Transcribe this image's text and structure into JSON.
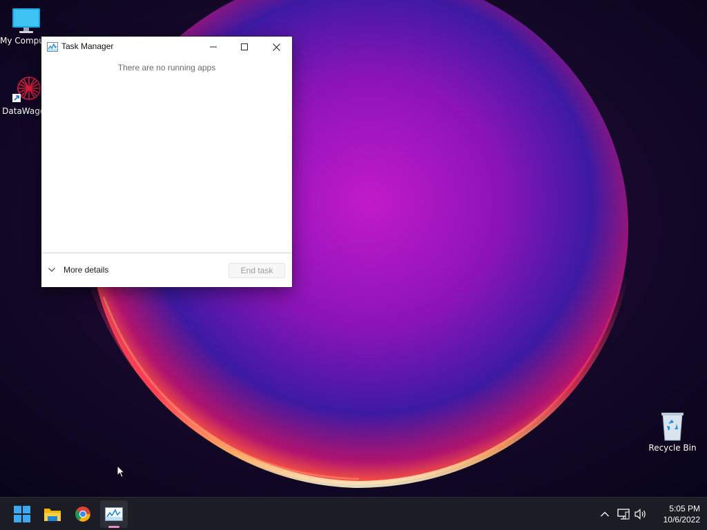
{
  "desktop": {
    "icons": [
      {
        "label": "My Computer",
        "icon": "monitor-icon"
      },
      {
        "label": "DataWagon",
        "icon": "datawagon-icon"
      },
      {
        "label": "Recycle Bin",
        "icon": "recycle-bin-icon"
      }
    ]
  },
  "task_manager": {
    "title": "Task Manager",
    "empty_message": "There are no running apps",
    "more_details_label": "More details",
    "end_task_label": "End task",
    "end_task_enabled": false
  },
  "taskbar": {
    "apps": [
      {
        "name": "Start",
        "icon": "windows-start-icon"
      },
      {
        "name": "File Explorer",
        "icon": "folder-icon"
      },
      {
        "name": "Google Chrome",
        "icon": "chrome-icon"
      },
      {
        "name": "Task Manager",
        "icon": "task-manager-icon",
        "active": true
      }
    ],
    "tray": {
      "icons": [
        "chevron-up-icon",
        "network-icon",
        "volume-icon"
      ],
      "time": "5:05 PM",
      "date": "10/6/2022"
    }
  },
  "colors": {
    "taskbar": "#1c1c24",
    "active_indicator": "#e58bd6",
    "window_bg": "#ffffff"
  }
}
